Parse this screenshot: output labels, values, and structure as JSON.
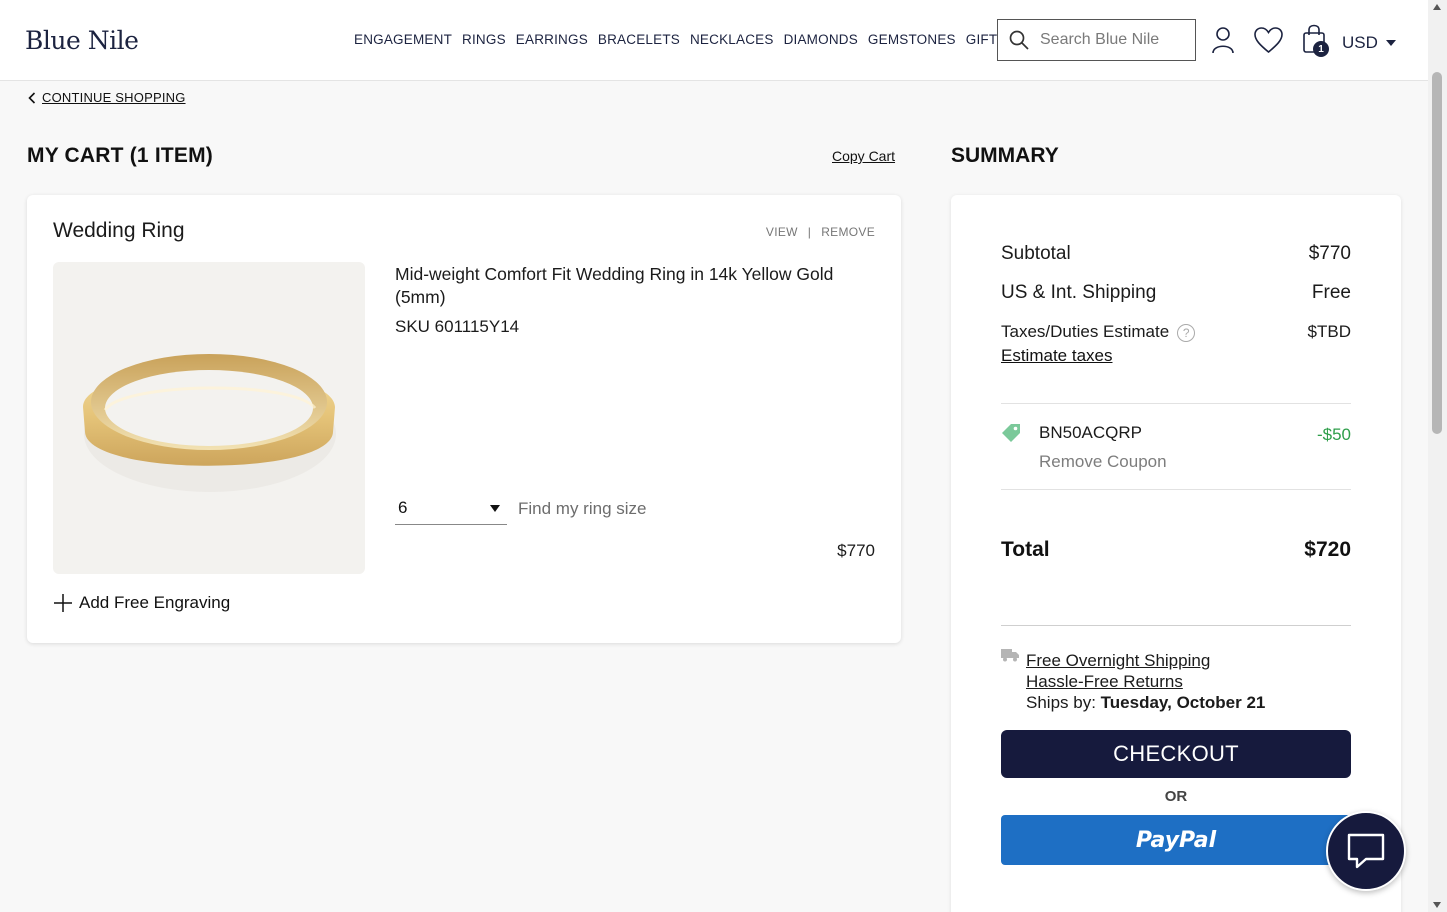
{
  "header": {
    "logo": "Blue Nile",
    "nav": [
      "ENGAGEMENT",
      "RINGS",
      "EARRINGS",
      "BRACELETS",
      "NECKLACES",
      "DIAMONDS",
      "GEMSTONES",
      "GIFTS"
    ],
    "search_placeholder": "Search Blue Nile",
    "bag_count": "1",
    "currency": "USD"
  },
  "breadcrumb": {
    "continue_label": "CONTINUE SHOPPING"
  },
  "cart": {
    "title": "MY CART (1 ITEM)",
    "copy_cart_label": "Copy Cart",
    "item": {
      "type": "Wedding Ring",
      "view_label": "VIEW",
      "separator": "|",
      "remove_label": "REMOVE",
      "name": "Mid-weight Comfort Fit Wedding Ring in 14k Yellow Gold (5mm)",
      "sku": "SKU 601115Y14",
      "ring_size": "6",
      "find_size_label": "Find my ring size",
      "price": "$770",
      "engraving_label": "Add Free Engraving"
    }
  },
  "summary": {
    "title": "SUMMARY",
    "subtotal_label": "Subtotal",
    "subtotal_value": "$770",
    "shipping_label": "US & Int. Shipping",
    "shipping_value": "Free",
    "taxes_label": "Taxes/Duties Estimate",
    "taxes_value": "$TBD",
    "estimate_taxes_label": "Estimate taxes",
    "coupon_code": "BN50ACQRP",
    "coupon_amount": "-$50",
    "remove_coupon_label": "Remove Coupon",
    "total_label": "Total",
    "total_value": "$720",
    "free_shipping_label": "Free Overnight Shipping",
    "returns_label": "Hassle-Free Returns",
    "ships_by_label": "Ships by:",
    "ships_by_date": "Tuesday, October 21",
    "checkout_label": "CHECKOUT",
    "or_label": "OR",
    "paypal_label": "PayPal"
  },
  "colors": {
    "brand_navy": "#161a3d",
    "paypal_blue": "#1e6fc4",
    "coupon_green": "#2e9e4a"
  }
}
